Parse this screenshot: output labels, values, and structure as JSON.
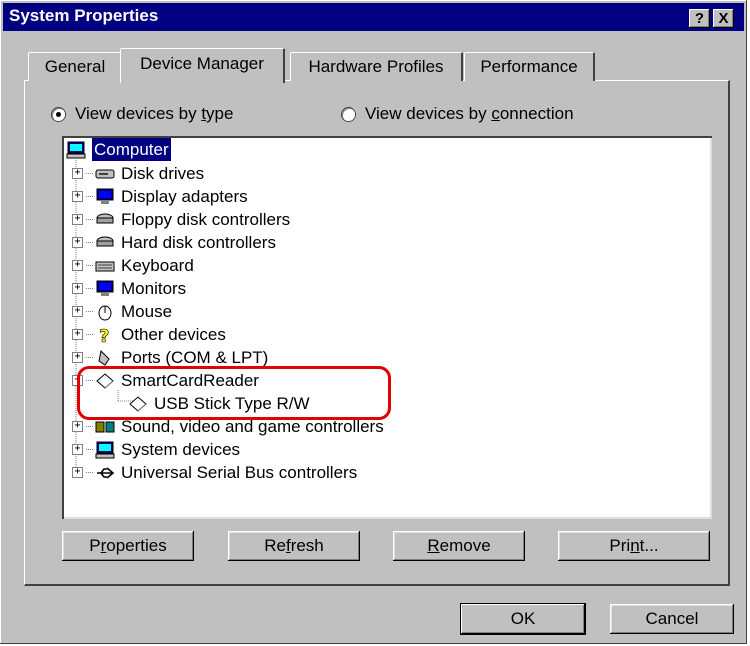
{
  "window": {
    "title": "System Properties",
    "help_label": "?",
    "close_label": "X"
  },
  "tabs": [
    {
      "label": "General"
    },
    {
      "label": "Device Manager",
      "active": true
    },
    {
      "label": "Hardware Profiles"
    },
    {
      "label": "Performance"
    }
  ],
  "view": {
    "by_type": {
      "pre": "View devices by ",
      "key": "t",
      "post": "ype",
      "selected": true
    },
    "by_connection": {
      "pre": "View devices by ",
      "key": "c",
      "post": "onnection",
      "selected": false
    }
  },
  "tree": {
    "root": "Computer",
    "items": [
      {
        "label": "Disk drives",
        "icon": "disk-drive-icon"
      },
      {
        "label": "Display adapters",
        "icon": "display-icon"
      },
      {
        "label": "Floppy disk controllers",
        "icon": "controller-icon"
      },
      {
        "label": "Hard disk controllers",
        "icon": "controller-icon"
      },
      {
        "label": "Keyboard",
        "icon": "keyboard-icon"
      },
      {
        "label": "Monitors",
        "icon": "monitor-icon"
      },
      {
        "label": "Mouse",
        "icon": "mouse-icon"
      },
      {
        "label": "Other devices",
        "icon": "question-icon"
      },
      {
        "label": "Ports (COM & LPT)",
        "icon": "port-icon"
      },
      {
        "label": "SmartCardReader",
        "icon": "diamond-icon"
      },
      {
        "label": "USB Stick Type R/W",
        "icon": "diamond-icon",
        "child": true
      },
      {
        "label": "Sound, video and game controllers",
        "icon": "sound-icon"
      },
      {
        "label": "System devices",
        "icon": "system-icon"
      },
      {
        "label": "Universal Serial Bus controllers",
        "icon": "usb-icon"
      }
    ]
  },
  "buttons": {
    "properties": {
      "pre": "P",
      "key": "r",
      "post": "operties"
    },
    "refresh": {
      "pre": "Re",
      "key": "f",
      "post": "resh"
    },
    "remove": {
      "pre": "",
      "key": "R",
      "post": "emove"
    },
    "print": {
      "pre": "Pri",
      "key": "n",
      "post": "t..."
    },
    "ok": "OK",
    "cancel": "Cancel"
  },
  "colors": {
    "titlebar": "#000080",
    "face": "#c0c0c0",
    "highlight_ring": "#e00000"
  }
}
